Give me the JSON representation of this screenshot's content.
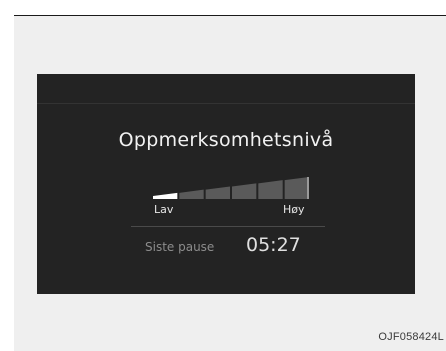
{
  "display": {
    "title": "Oppmerksomhetsnivå",
    "attention_level": {
      "segments_total": 6,
      "segments_active": 1,
      "low_label": "Lav",
      "high_label": "Høy",
      "active_color": "#ffffff",
      "inactive_color": "#5a5a5a"
    },
    "last_pause": {
      "label": "Siste pause",
      "time": "05:27"
    }
  },
  "caption": "OJF058424L"
}
